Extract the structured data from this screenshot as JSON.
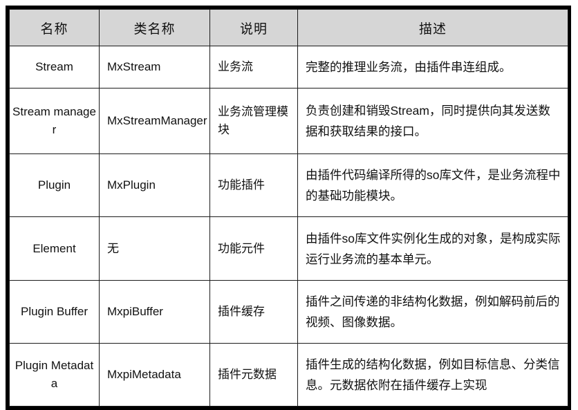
{
  "table": {
    "headers": [
      "名称",
      "类名称",
      "说明",
      "描述"
    ],
    "rows": [
      {
        "name": "Stream",
        "class_name": "MxStream",
        "summary": "业务流",
        "description": "完整的推理业务流，由插件串连组成。"
      },
      {
        "name": "Stream manager",
        "class_name": "MxStreamManager",
        "summary": "业务流管理模块",
        "description": "负责创建和销毁Stream，同时提供向其发送数据和获取结果的接口。"
      },
      {
        "name": "Plugin",
        "class_name": "MxPlugin",
        "summary": "功能插件",
        "description": "由插件代码编译所得的so库文件，是业务流程中的基础功能模块。"
      },
      {
        "name": "Element",
        "class_name": "无",
        "summary": "功能元件",
        "description": "由插件so库文件实例化生成的对象，是构成实际运行业务流的基本单元。"
      },
      {
        "name": "Plugin Buffer",
        "class_name": "MxpiBuffer",
        "summary": "插件缓存",
        "description": "插件之间传递的非结构化数据，例如解码前后的视频、图像数据。"
      },
      {
        "name": "Plugin Metadata",
        "class_name": "MxpiMetadata",
        "summary": "插件元数据",
        "description": "插件生成的结构化数据，例如目标信息、分类信息。元数据依附在插件缓存上实现"
      }
    ]
  },
  "colors": {
    "header_background": "#d6d6d6",
    "border": "#1a1a1a",
    "outer_border": "#000000",
    "text": "#111111",
    "page_background": "#ffffff"
  }
}
